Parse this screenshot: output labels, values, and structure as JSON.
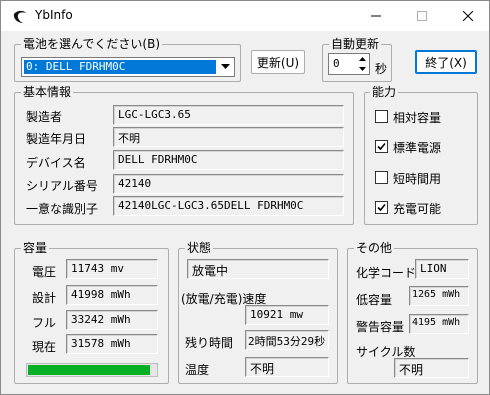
{
  "window": {
    "title": "YbInfo"
  },
  "battery_select": {
    "label": "電池を選んでください(B)",
    "selected": "0: DELL FDRHM0C"
  },
  "update_button": "更新(U)",
  "auto_update": {
    "label": "自動更新",
    "value": "0",
    "unit": "秒"
  },
  "exit_button": "終了(X)",
  "basic_info": {
    "title": "基本情報",
    "rows": [
      {
        "label": "製造者",
        "value": "LGC-LGC3.65"
      },
      {
        "label": "製造年月日",
        "value": "不明"
      },
      {
        "label": "デバイス名",
        "value": "DELL FDRHM0C"
      },
      {
        "label": "シリアル番号",
        "value": "42140"
      },
      {
        "label": "一意な識別子",
        "value": "42140LGC-LGC3.65DELL FDRHM0C"
      }
    ]
  },
  "capabilities": {
    "title": "能力",
    "items": [
      {
        "label": "相対容量",
        "checked": false
      },
      {
        "label": "標準電源",
        "checked": true
      },
      {
        "label": "短時間用",
        "checked": false
      },
      {
        "label": "充電可能",
        "checked": true
      }
    ]
  },
  "capacity": {
    "title": "容量",
    "rows": [
      {
        "label": "電圧",
        "value": "11743 mv"
      },
      {
        "label": "設計",
        "value": "41998 mWh"
      },
      {
        "label": "フル",
        "value": "33242 mWh"
      },
      {
        "label": "現在",
        "value": "31578 mWh"
      }
    ],
    "charge_fraction": 0.95,
    "bar_color": "#06b025"
  },
  "state": {
    "title": "状態",
    "status": "放電中",
    "rate_label": "(放電/充電)速度",
    "rate_value": "10921 mw",
    "remaining_label": "残り時間",
    "remaining_value": "2時間53分29秒",
    "temp_label": "温度",
    "temp_value": "不明"
  },
  "other": {
    "title": "その他",
    "chemistry_label": "化学コード",
    "chemistry_value": "LION",
    "low_label": "低容量",
    "low_value": "1265 mWh",
    "warn_label": "警告容量",
    "warn_value": "4195 mWh",
    "cycle_label": "サイクル数",
    "cycle_value": "不明"
  }
}
